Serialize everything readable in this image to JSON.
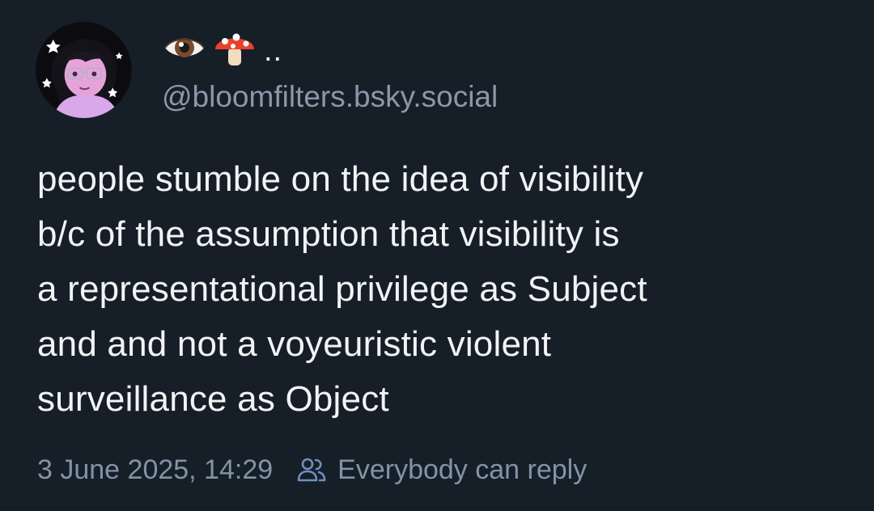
{
  "post": {
    "author": {
      "display_name_emojis": [
        "eye-emoji",
        "mushroom-emoji"
      ],
      "display_name_suffix": "..",
      "handle": "@bloomfilters.bsky.social"
    },
    "text_lines": [
      "people stumble on the idea of visibility",
      "b/c of the assumption that visibility is",
      "a representational privilege as Subject",
      "and and not a voyeuristic violent",
      "surveillance as Object"
    ],
    "timestamp": "3 June 2025, 14:29",
    "reply_setting": "Everybody can reply"
  },
  "colors": {
    "background": "#161e27",
    "text": "#f1f3f5",
    "muted": "#8a98aa",
    "reply_icon": "#6f8fbf"
  }
}
